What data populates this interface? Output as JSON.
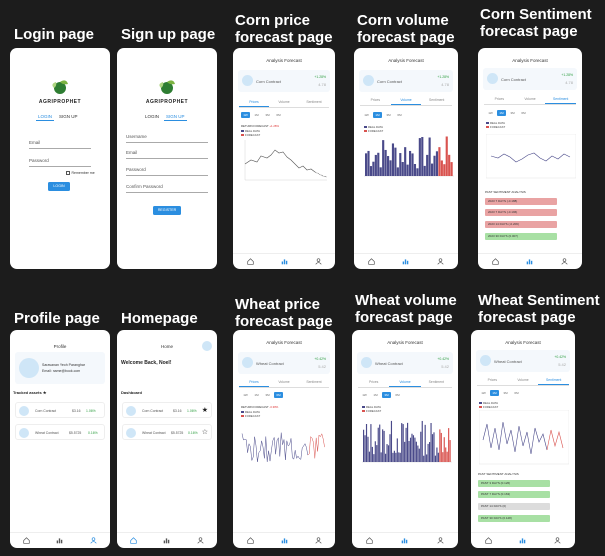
{
  "captions": {
    "login": "Login page",
    "signup": "Sign up page",
    "corn_price": [
      "Corn price",
      "forecast page"
    ],
    "corn_volume": [
      "Corn volume",
      "forecast page"
    ],
    "corn_sentiment": [
      "Corn Sentiment",
      "forecast page"
    ],
    "profile": "Profile page",
    "homepage": "Homepage",
    "wheat_price": [
      "Wheat price",
      "forecast page"
    ],
    "wheat_volume": [
      "Wheat volume",
      "forecast page"
    ],
    "wheat_sentiment": [
      "Wheat Sentiment",
      "forecast page"
    ]
  },
  "brand": "AGRIPROPHET",
  "login": {
    "tab_login": "LOGIN",
    "tab_signup": "SIGN UP",
    "email": "Email",
    "password": "Password",
    "remember": "Remember me",
    "button": "LOGIN"
  },
  "signup": {
    "tab_login": "LOGIN",
    "tab_signup": "SIGN UP",
    "username": "Username",
    "email": "Email",
    "password": "Password",
    "confirm": "Confirm Password",
    "button": "REGISTER"
  },
  "forecast": {
    "title": "Analysis Forecast",
    "tabs": [
      "Prices",
      "Volume",
      "Sentiment"
    ],
    "timeframes": [
      "1W",
      "1M",
      "3M",
      "6M"
    ],
    "legend_real": "REAL DATA",
    "legend_forecast": "FORECAST",
    "return_label": "RETURN FORECAST",
    "sent_header": "PAST SENTIMENT ANALYSIS"
  },
  "corn": {
    "name": "Corn Contract",
    "change": "+1.28%",
    "price": "4.78",
    "return": "+1.28%"
  },
  "wheat": {
    "name": "Wheat Contract",
    "change": "+0.42%",
    "price": "5.42",
    "return": "-0.38%"
  },
  "corn_sent": [
    "2023 7 DAYS (-0.188)",
    "2023 7 DAYS (-0.196)",
    "2023 14 DAYS (-0.206)",
    "2023 30 DAYS (0.007)"
  ],
  "wheat_sent": [
    "PAST 3 DAYS (0.126)",
    "PAST 7 DAYS (0.163)",
    "PAST 14 DAYS (0)",
    "PAST 30 DAYS (0.128)"
  ],
  "profile": {
    "title": "Profile",
    "name": "Saravanan Yeoh Paranghar",
    "email": "Email: name@book.com",
    "tracked": "Tracked assets",
    "rows": [
      {
        "name": "Corn Contract",
        "price": "$3.16",
        "change": "1.06%"
      },
      {
        "name": "Wheat Contract",
        "price": "$5.5725",
        "change": "0.16%"
      }
    ]
  },
  "home": {
    "title": "Home",
    "welcome": "Welcome Back, Noel!",
    "dashboard": "Dashboard",
    "rows": [
      {
        "name": "Corn Contract",
        "price": "$3.16",
        "change": "1.06%"
      },
      {
        "name": "Wheat Contract",
        "price": "$5.5725",
        "change": "0.16%"
      }
    ]
  },
  "colors": {
    "accent": "#2b8ee0",
    "real": "#4a4a8a",
    "forecast": "#d9534f"
  }
}
